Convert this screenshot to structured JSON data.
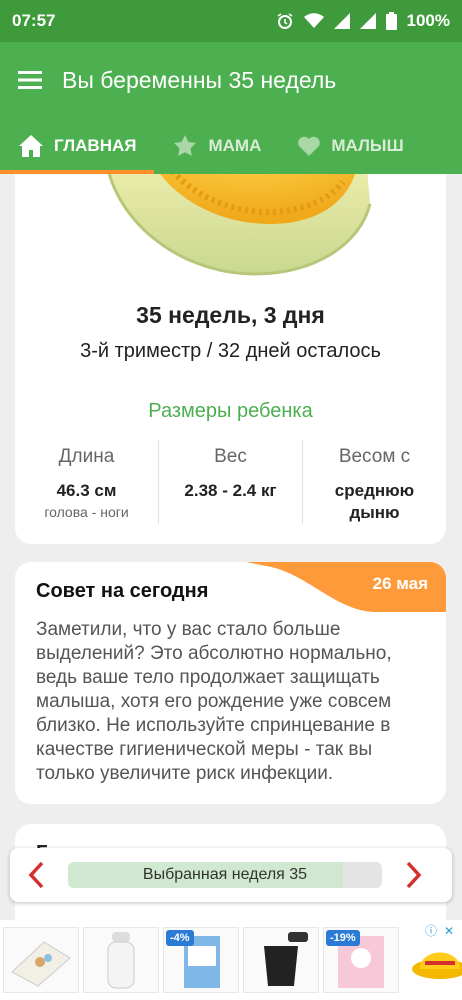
{
  "status_bar": {
    "time": "07:57",
    "battery": "100%",
    "icons": [
      "alarm-icon",
      "wifi-icon",
      "signal-icon",
      "signal-icon",
      "battery-icon"
    ]
  },
  "app_bar": {
    "title": "Вы беременны 35 недель",
    "menu_icon": "menu-icon"
  },
  "tabs": [
    {
      "label": "ГЛАВНАЯ",
      "icon": "home-icon",
      "active": true
    },
    {
      "label": "МАМА",
      "icon": "star-icon",
      "active": false
    },
    {
      "label": "МАЛЫШ",
      "icon": "heart-icon",
      "active": false
    }
  ],
  "week_card": {
    "image": "melon-slice",
    "title": "35 недель, 3 дня",
    "subtitle": "3-й триместр / 32 дней осталось",
    "sizes_link": "Размеры ребенка",
    "stats": [
      {
        "label": "Длина",
        "value": "46.3 см",
        "sub": "голова - ноги"
      },
      {
        "label": "Вес",
        "value": "2.38 - 2.4 кг",
        "sub": ""
      },
      {
        "label": "Весом с",
        "value": "среднюю дыню",
        "sub": ""
      }
    ]
  },
  "tip_card": {
    "title": "Совет на сегодня",
    "date": "26 мая",
    "text": "Заметили, что у вас стало больше выделений? Это абсолютно нормально, ведь ваше тело продолжает защищать малыша, хотя его рождение уже совсем близко. Не используйте спринцевание в качестве гигиенической меры - так вы только увеличите риск инфекции."
  },
  "next_card": {
    "title": "Гр"
  },
  "week_selector": {
    "label": "Выбранная неделя 35",
    "progress": 0.875,
    "prev_icon": "chevron-left-icon",
    "next_icon": "chevron-right-icon"
  },
  "ads": {
    "items": [
      {
        "badge": ""
      },
      {
        "badge": ""
      },
      {
        "badge": "-4%"
      },
      {
        "badge": ""
      },
      {
        "badge": "-19%"
      },
      {
        "badge": ""
      }
    ],
    "info_icon": "info-icon",
    "close_icon": "close-icon"
  },
  "colors": {
    "status_bar": "#3f9a3c",
    "primary": "#4caf50",
    "accent": "#ff9a3a",
    "chevron": "#d32f2f"
  }
}
